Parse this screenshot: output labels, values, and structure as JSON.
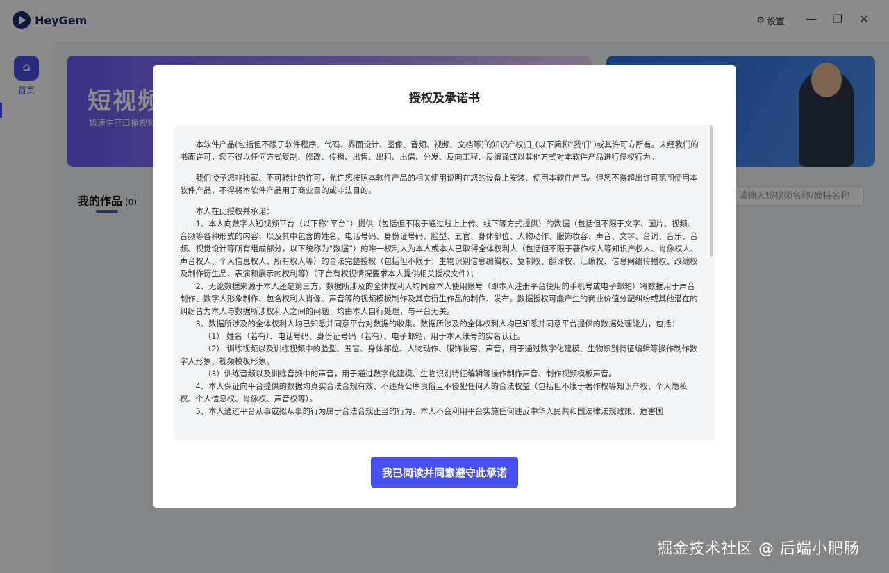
{
  "app": {
    "name": "HeyGem",
    "settings_label": "设置"
  },
  "sidebar": {
    "home_label": "首页"
  },
  "banner": {
    "title": "短视频",
    "subtitle": "极速生产口播视频"
  },
  "works": {
    "tab_label": "我的作品",
    "count": "(0)",
    "search_placeholder": "请输入短视频名称/模特名称"
  },
  "modal": {
    "title": "授权及承诺书",
    "paragraphs": [
      "本软件产品(包括但不限于软件程序、代码、界面设计、图像、音频、视频、文档等)的知识产权归_(以下简称“我们”)或其许可方所有。未经我们的书面许可，您不得以任何方式复制、修改、传播、出售、出租、出借、分发、反向工程、反编译或以其他方式对本软件产品进行侵权行为。",
      "我们授予您非独家、不可转让的许可，允许您按照本软件产品的相关使用说明在您的设备上安装、使用本软件产品。但您不得超出许可范围使用本软件产品，不得将本软件产品用于商业目的或非法目的。"
    ],
    "commitment_lines": [
      "本人在此授权并承诺：",
      "1、本人向数字人短视频平台（以下称“平台”）提供（包括但不限于通过线上上传、线下等方式提供）的数据（包括但不限于文字、图片、视频、音频等各种形式的内容，以及其中包含的姓名、电话号码、身份证号码、脸型、五官、身体部位、人物动作、服饰妆容、声音、文字、台词、音乐、音频、视觉设计等所有组成部分，以下统称为“数据”）的唯一权利人为本人或本人已取得全体权利人（包括但不限于著作权人等知识产权人、肖像权人、声音权人、个人信息权人、所有权人等）的合法完整授权（包括但不限于：生物识别信息编辑权、复制权、翻译权、汇编权、信息网络传播权、改编权及制作衍生品、表演和展示的权利等）（平台有权视情况要求本人提供相关授权文件）；",
      "2、无论数据来源于本人还是第三方，数据所涉及的全体权利人均同意本人使用账号（即本人注册平台使用的手机号或电子邮箱）将数据用于声音制作、数字人形象制作、包含权利人肖像、声音等的视频模板制作及其它衍生作品的制作、发布。数据授权可能产生的商业价值分配纠纷或其他潜在的纠纷皆为本人与数据所涉权利人之间的问题，均由本人自行处理，与平台无关。",
      "3、数据所涉及的全体权利人均已知悉并同意平台对数据的收集。数据所涉及的全体权利人均已知悉并同意平台提供的数据处理能力，包括：",
      "（1） 姓名（若有）、电话号码、身份证号码（若有）、电子邮箱，用于本人账号的实名认证。",
      "（2） 训练视频以及训练视频中的脸型、五官、身体部位、人物动作、服饰妆容、声音，用于通过数字化建模、生物识别特征编辑等操作制作数字人形象、视频模板形象。",
      "（3）训练音频以及训练音频中的声音，用于通过数字化建模、生物识别特征编辑等操作制作声音、制作视频模板声音。",
      "4、本人保证向平台提供的数据均真实合法合规有效、不违背公序良俗且不侵犯任何人的合法权益（包括但不限于著作权等知识产权、个人隐私权、个人信息权、肖像权、声音权等）。",
      "5、本人通过平台从事或拟从事的行为属于合法合规正当的行为。本人不会利用平台实施任何违反中华人民共和国法律法规政策、危害国"
    ],
    "agree_button": "我已阅读并同意遵守此承诺"
  },
  "watermark": "掘金技术社区 @ 后端小肥肠"
}
